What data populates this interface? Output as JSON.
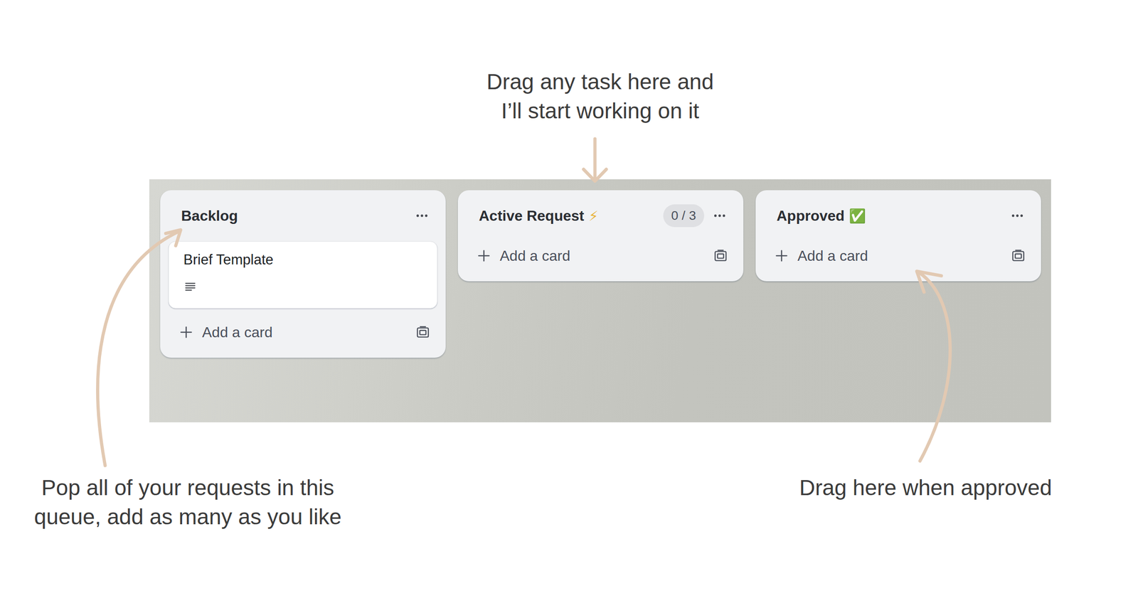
{
  "annotations": {
    "active": {
      "lines": [
        "Drag any task here and",
        "I’ll start working on it"
      ]
    },
    "backlog": {
      "lines": [
        "Pop all of your requests in this",
        "queue, add as many as you like"
      ]
    },
    "approved": {
      "lines": [
        "Drag here when approved"
      ]
    }
  },
  "board": {
    "lists": [
      {
        "title": "Backlog",
        "emoji": "",
        "count": "",
        "cards": [
          {
            "title": "Brief Template",
            "has_description": true
          }
        ],
        "add_label": "Add a card"
      },
      {
        "title": "Active Request",
        "emoji": "⚡",
        "count": "0 / 3",
        "cards": [],
        "add_label": "Add a card"
      },
      {
        "title": "Approved",
        "emoji": "✅",
        "count": "",
        "cards": [],
        "add_label": "Add a card"
      }
    ]
  }
}
